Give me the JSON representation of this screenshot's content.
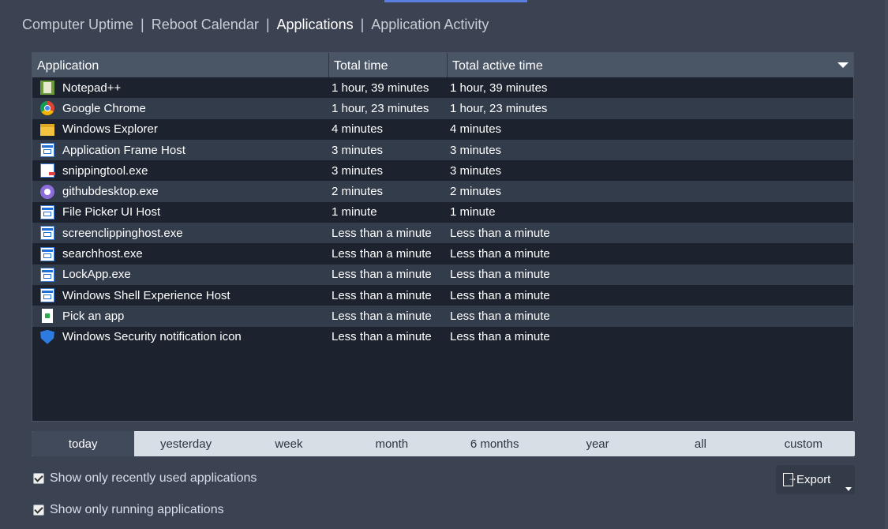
{
  "nav": {
    "items": [
      "Computer Uptime",
      "Reboot Calendar",
      "Applications",
      "Application Activity"
    ],
    "separator": "|",
    "active_index": 2
  },
  "table": {
    "headers": [
      "Application",
      "Total time",
      "Total active time"
    ],
    "rows": [
      {
        "icon": "notepad-plus-plus-icon",
        "name": "Notepad++",
        "total": "1 hour, 39 minutes",
        "active": "1 hour, 39 minutes"
      },
      {
        "icon": "chrome-icon",
        "name": "Google Chrome",
        "total": "1 hour, 23 minutes",
        "active": "1 hour, 23 minutes"
      },
      {
        "icon": "folder-icon",
        "name": "Windows Explorer",
        "total": "4 minutes",
        "active": "4 minutes"
      },
      {
        "icon": "window-icon",
        "name": "Application Frame Host",
        "total": "3 minutes",
        "active": "3 minutes"
      },
      {
        "icon": "snipping-tool-icon",
        "name": "snippingtool.exe",
        "total": "3 minutes",
        "active": "3 minutes"
      },
      {
        "icon": "github-desktop-icon",
        "name": "githubdesktop.exe",
        "total": "2 minutes",
        "active": "2 minutes"
      },
      {
        "icon": "window-icon",
        "name": "File Picker UI Host",
        "total": "1 minute",
        "active": "1 minute"
      },
      {
        "icon": "window-icon",
        "name": "screenclippinghost.exe",
        "total": "Less than a minute",
        "active": "Less than a minute"
      },
      {
        "icon": "window-icon",
        "name": "searchhost.exe",
        "total": "Less than a minute",
        "active": "Less than a minute"
      },
      {
        "icon": "window-icon",
        "name": "LockApp.exe",
        "total": "Less than a minute",
        "active": "Less than a minute"
      },
      {
        "icon": "window-icon",
        "name": "Windows Shell Experience Host",
        "total": "Less than a minute",
        "active": "Less than a minute"
      },
      {
        "icon": "pick-app-icon",
        "name": "Pick an app",
        "total": "Less than a minute",
        "active": "Less than a minute"
      },
      {
        "icon": "shield-icon",
        "name": "Windows Security notification icon",
        "total": "Less than a minute",
        "active": "Less than a minute"
      }
    ]
  },
  "ranges": {
    "items": [
      "today",
      "yesterday",
      "week",
      "month",
      "6 months",
      "year",
      "all",
      "custom"
    ],
    "selected_index": 0
  },
  "options": {
    "recent_label": "Show only recently used applications",
    "recent_checked": true,
    "running_label": "Show only running applications",
    "running_checked": true
  },
  "export": {
    "label": "Export"
  },
  "colors": {
    "accent": "#5b7fe0",
    "background": "#3b4252",
    "table_bg": "#1c232e",
    "row_alt": "#333c4b"
  }
}
